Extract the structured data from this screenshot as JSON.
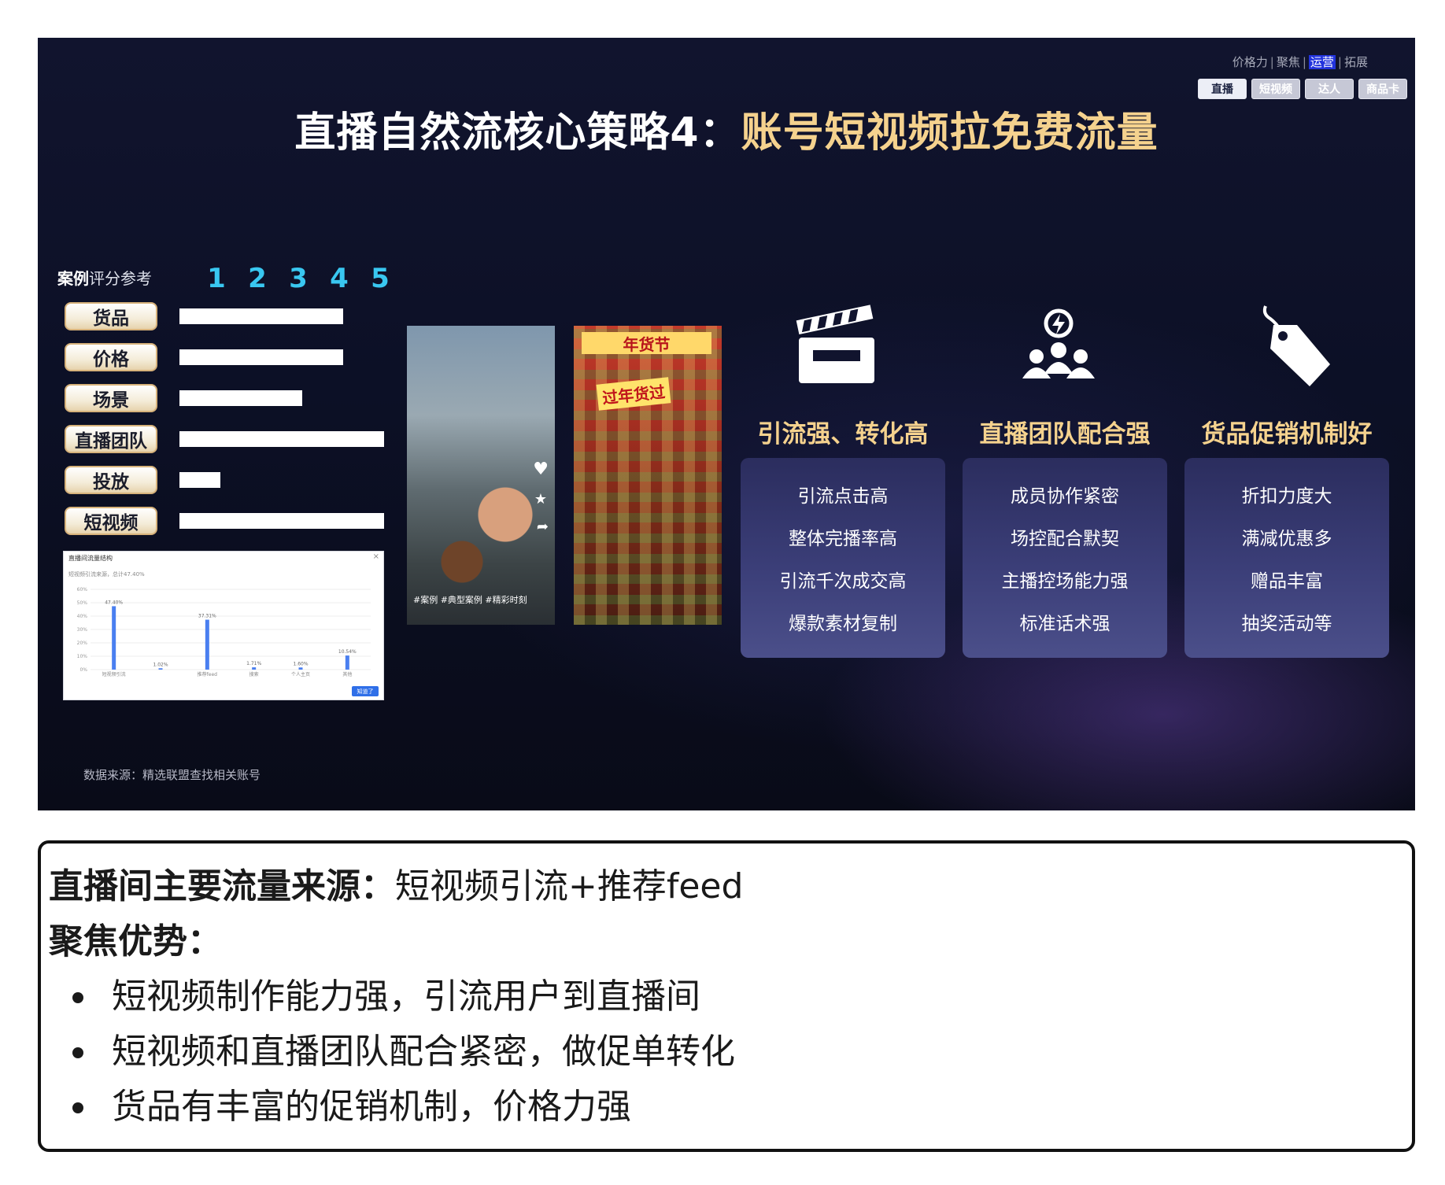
{
  "slide": {
    "title_main": "直播自然流核心策略4：",
    "title_highlight": "账号短视频拉免费流量",
    "topnav": [
      "价格力",
      "聚焦",
      "运营",
      "拓展"
    ],
    "topnav_active_index": 2,
    "nav_buttons": [
      "直播",
      "短视频",
      "达人",
      "商品卡"
    ],
    "nav_active_index": 0,
    "rating": {
      "title_bold": "案例",
      "title_light": "评分参考",
      "scale": [
        "1",
        "2",
        "3",
        "4",
        "5"
      ],
      "items": [
        {
          "label": "货品",
          "score": 4
        },
        {
          "label": "价格",
          "score": 4
        },
        {
          "label": "场景",
          "score": 3
        },
        {
          "label": "直播团队",
          "score": 5
        },
        {
          "label": "投放",
          "score": 1
        },
        {
          "label": "短视频",
          "score": 5
        }
      ]
    },
    "mini_chart": {
      "title": "直播间流量结构",
      "subtitle": "短视频引流来源，总计47.40%",
      "close": "×",
      "button": "知道了",
      "chart_data": {
        "type": "bar",
        "categories": [
          "短视频引流",
          "",
          "推荐feed",
          "搜索",
          "个人主页",
          "其他"
        ],
        "values": [
          47.4,
          1.02,
          37.31,
          1.71,
          1.6,
          10.54
        ],
        "data_labels": [
          "47.40%",
          "1.02%",
          "37.31%",
          "1.71%",
          "1.60%",
          "10.54%"
        ],
        "ylim": [
          0,
          60
        ],
        "yticks": [
          "60%",
          "50%",
          "40%",
          "30%",
          "20%",
          "10%",
          "0%"
        ],
        "color": "#4a7ff0"
      }
    },
    "data_source": "数据来源：精选联盟查找相关账号",
    "phones": [
      {
        "caption": "#案例 #典型案例 #精彩时刻"
      },
      {
        "banner": "年货节",
        "badge": "过年货过"
      }
    ],
    "features": [
      {
        "title": "引流强、转化高",
        "icon": "clapperboard-icon",
        "lines": [
          "引流点击高",
          "整体完播率高",
          "引流千次成交高",
          "爆款素材复制"
        ]
      },
      {
        "title": "直播团队配合强",
        "icon": "team-idea-icon",
        "lines": [
          "成员协作紧密",
          "场控配合默契",
          "主播控场能力强",
          "标准话术强"
        ]
      },
      {
        "title": "货品促销机制好",
        "icon": "price-tag-icon",
        "lines": [
          "折扣力度大",
          "满减优惠多",
          "赠品丰富",
          "抽奖活动等"
        ]
      }
    ],
    "colors": {
      "accent": "#f5d28e",
      "scale": "#39c7f0",
      "card": "#3b3e78"
    }
  },
  "notes": {
    "source_label": "直播间主要流量来源：",
    "source_value": "短视频引流+推荐feed",
    "focus_label": "聚焦优势：",
    "bullets": [
      "短视频制作能力强，引流用户到直播间",
      "短视频和直播团队配合紧密，做促单转化",
      "货品有丰富的促销机制，价格力强"
    ]
  }
}
